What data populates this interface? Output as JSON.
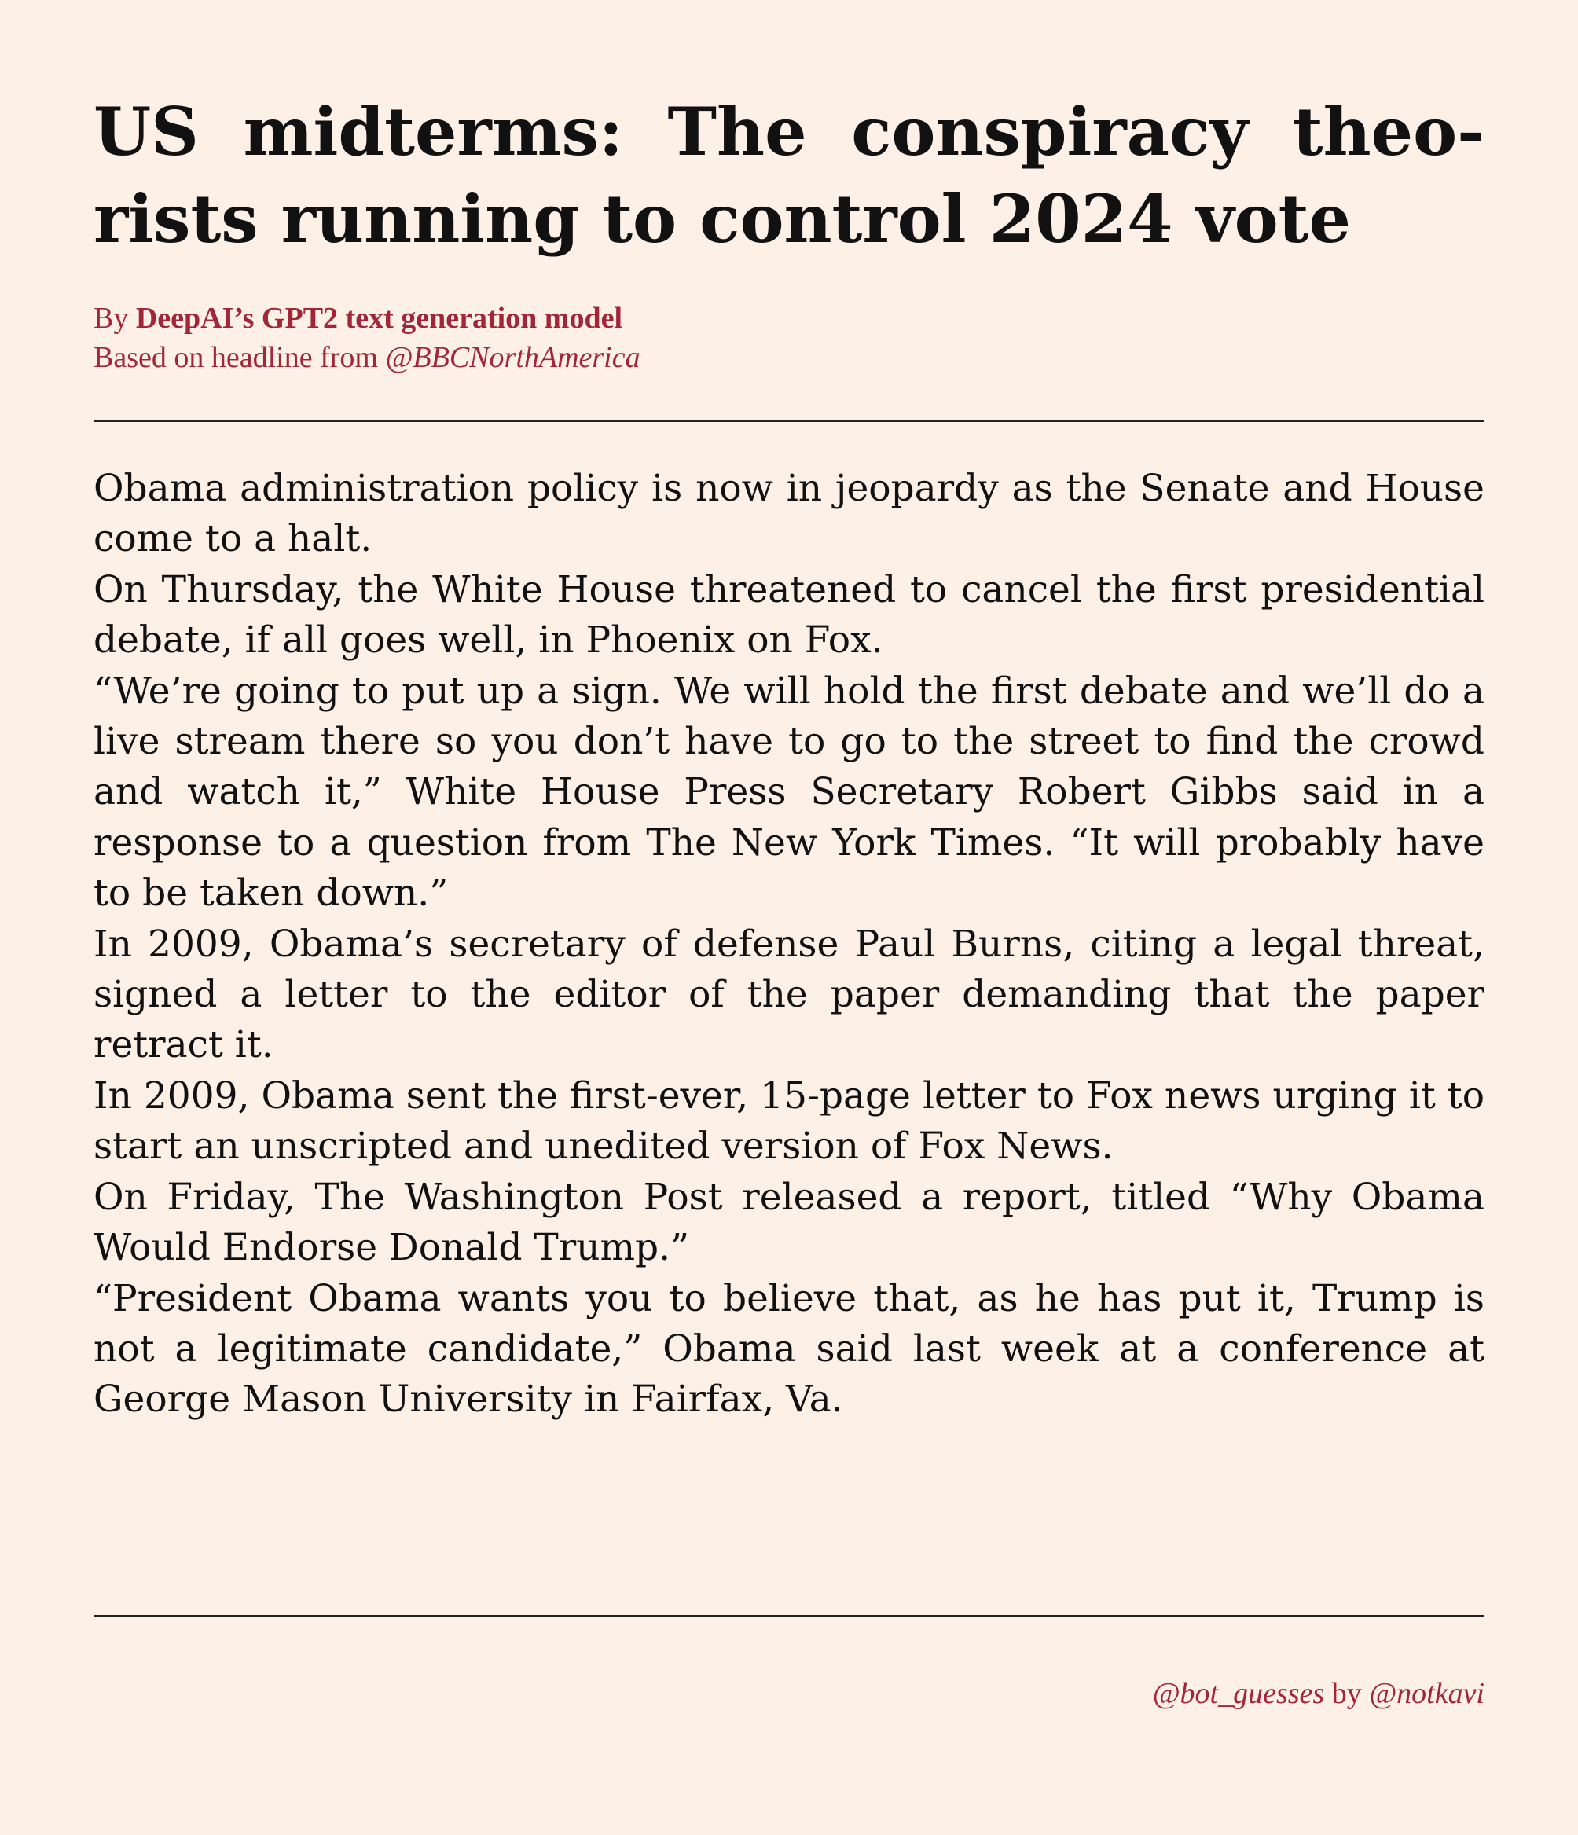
{
  "headline": "US midterms: The conspiracy theo­rists running to control 2024 vote",
  "byline": {
    "prefix": "By ",
    "author": "DeepAI’s GPT2 text generation model",
    "source_prefix": "Based on headline from ",
    "source_handle": "@BBCNorthAmerica"
  },
  "paragraphs": [
    "Obama administration policy is now in jeopardy as the Senate and House come to a halt.",
    "On Thursday, the White House threatened to cancel the first presi­dential debate, if all goes well, in Phoenix on Fox.",
    "“We’re going to put up a sign. We will hold the first debate and we’ll do a live stream there so you don’t have to go to the street to find the crowd and watch it,” White House Press Secretary Robert Gibbs said in a response to a question from The New York Times. “It will probably have to be taken down.”",
    "In 2009, Obama’s secretary of defense Paul Burns, citing a legal threat, signed a letter to the editor of the paper demanding that the paper retract it.",
    "In 2009, Obama sent the first-ever, 15-page letter to Fox news urging it to start an unscripted and unedited version of Fox News.",
    "On Friday, The Washington Post released a report, titled “Why Obama Would Endorse Donald Trump.”",
    "“President Obama wants you to believe that, as he has put it, Trump is not a legitimate candidate,” Obama said last week at a conference at George Mason University in Fairfax, Va."
  ],
  "footer": {
    "bot_handle": "@bot_guesses",
    "by": " by ",
    "author_handle": "@notkavi"
  },
  "colors": {
    "background": "#fdf0e7",
    "accent": "#a32638",
    "text": "#111111"
  }
}
